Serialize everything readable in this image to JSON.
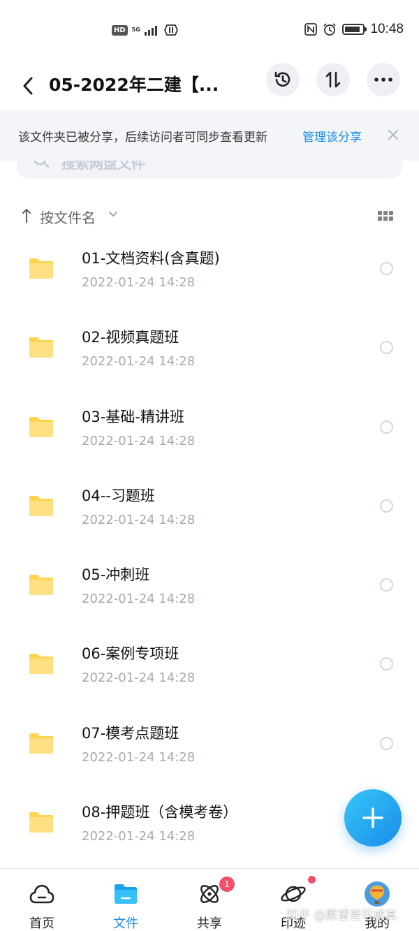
{
  "status_bar": {
    "hd": "HD",
    "network": "5G",
    "time": "10:48",
    "battery_level": 0.85,
    "icons": [
      "hd-icon",
      "signal-icon",
      "hotspot-icon",
      "nfc-icon",
      "alarm-icon",
      "battery-icon"
    ]
  },
  "header": {
    "title": "05-2022年二建【...",
    "buttons": [
      "back-icon",
      "history-icon",
      "sort-swap-icon",
      "more-icon"
    ]
  },
  "share_banner": {
    "message": "该文件夹已被分享，后续访问者可同步查看更新",
    "link": "管理该分享"
  },
  "search": {
    "placeholder": "搜索网盘文件"
  },
  "sort": {
    "label": "按文件名"
  },
  "files": [
    {
      "name": "01-文档资料(含真题)",
      "date": "2022-01-24  14:28"
    },
    {
      "name": "02-视频真题班",
      "date": "2022-01-24  14:28"
    },
    {
      "name": "03-基础-精讲班",
      "date": "2022-01-24  14:28"
    },
    {
      "name": "04--习题班",
      "date": "2022-01-24  14:28"
    },
    {
      "name": "05-冲刺班",
      "date": "2022-01-24  14:28"
    },
    {
      "name": "06-案例专项班",
      "date": "2022-01-24  14:28"
    },
    {
      "name": "07-模考点题班",
      "date": "2022-01-24  14:28"
    },
    {
      "name": "08-押题班（含模考卷）",
      "date": "2022-01-24  14:28"
    }
  ],
  "tabs": [
    {
      "label": "首页",
      "icon": "home-cloud-icon"
    },
    {
      "label": "文件",
      "icon": "folder-icon",
      "active": true
    },
    {
      "label": "共享",
      "icon": "atom-icon",
      "badge": "1"
    },
    {
      "label": "印迹",
      "icon": "planet-icon"
    },
    {
      "label": "我的",
      "icon": "avatar-balloon-icon"
    }
  ],
  "watermark": "知乎 @愿望皆可成真",
  "colors": {
    "accent": "#1a8ce8",
    "folder": "#ffd54f",
    "badge": "#f0506e",
    "banner_bg": "#f4f5f8"
  }
}
